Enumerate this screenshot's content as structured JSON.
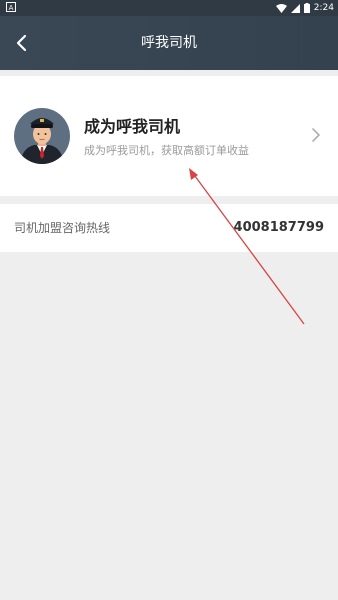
{
  "status_bar": {
    "time": "2:24",
    "icons": [
      "notification-a-icon",
      "wifi-icon",
      "signal-icon",
      "battery-icon"
    ]
  },
  "nav": {
    "title": "呼我司机",
    "back_icon": "back-arrow-icon"
  },
  "driver_card": {
    "avatar": "driver-avatar",
    "title": "成为呼我司机",
    "subtitle": "成为呼我司机，获取高额订单收益",
    "chevron_icon": "chevron-right-icon"
  },
  "hotline": {
    "label": "司机加盟咨询热线",
    "number": "4008187799"
  },
  "colors": {
    "nav_background": "#34424f",
    "page_background": "#eeeeee",
    "annotation_arrow": "#d64545"
  }
}
